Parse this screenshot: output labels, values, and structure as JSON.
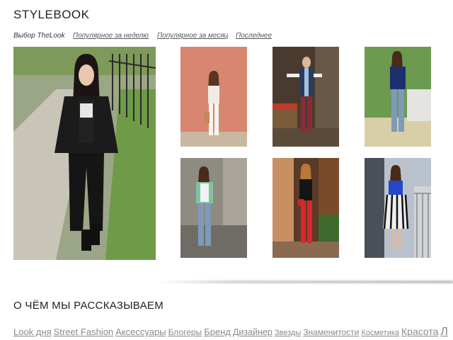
{
  "header": {
    "title": "STYLEBOOK"
  },
  "tabs": {
    "active": "Выбор TheLook",
    "items": [
      "Популярное за неделю",
      "Популярное за месяц",
      "Последнее"
    ]
  },
  "section": {
    "title": "О ЧЁМ МЫ РАССКАЗЫВАЕМ"
  },
  "tags": [
    "Look дня",
    "Street Fashion",
    "Аксессуары",
    "Блогеры",
    "Бренд",
    "Дизайнер",
    "Звезды",
    "Знаменитости",
    "Косметика",
    "Красота",
    "Л"
  ],
  "photos": [
    {
      "name": "featured-look-photo",
      "bg": "#8a9a7a",
      "top": "#1a1a1a",
      "bottom": "#1a1a1a"
    },
    {
      "name": "look-photo-1",
      "bg": "#d9826f",
      "top": "#f2efe8",
      "bottom": "#f4f4f0"
    },
    {
      "name": "look-photo-2",
      "bg": "#4a3a2e",
      "top": "#2d3b5a",
      "bottom": "#8a2a3a"
    },
    {
      "name": "look-photo-3",
      "bg": "#6c9a4e",
      "top": "#1e2f6e",
      "bottom": "#7f9ab8"
    },
    {
      "name": "look-photo-4",
      "bg": "#8e8b82",
      "top": "#7fc4a2",
      "bottom": "#7f9ab8"
    },
    {
      "name": "look-photo-5",
      "bg": "#5a3a28",
      "top": "#151515",
      "bottom": "#d8282a"
    },
    {
      "name": "look-photo-6",
      "bg": "#b9c2cc",
      "top": "#2446c8",
      "bottom": "#eeeeee"
    }
  ]
}
